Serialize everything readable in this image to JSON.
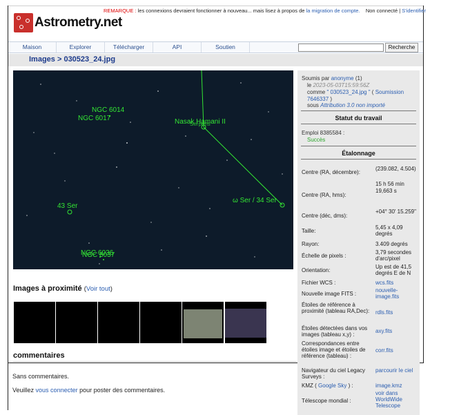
{
  "top_bar": {
    "remark_label": "REMARQUE :",
    "remark_text": "les connexions devraient fonctionner à nouveau... mais lisez à propos de",
    "migration_link": "la migration de compte.",
    "status": "Non connecté",
    "separator": "|",
    "login_link": "S'identifier"
  },
  "logo": {
    "text": "Astrometry.net"
  },
  "nav": {
    "items": [
      "Maison",
      "Explorer",
      "Télécharger",
      "API",
      "Soutien"
    ],
    "search_placeholder": "",
    "search_button": "Recherche"
  },
  "breadcrumb": {
    "text": "Images > 030523_24.jpg"
  },
  "sky_labels": {
    "ngc6014": "NGC 6014",
    "ngc6017": "NGC 6017",
    "nasak": "Nasak Hamani II",
    "nasak_overlap": "Serpens",
    "omega": "ω Ser / 34 Ser",
    "ser43": "43 Ser",
    "ngc6036": "NGC 6036",
    "ngc6037": "NGC 6037"
  },
  "nearby": {
    "title": "Images à proximité",
    "open_paren": "(",
    "link": "Voir tout",
    "close_paren": ")"
  },
  "comments": {
    "title": "commentaires",
    "none": "Sans commentaires.",
    "login_prefix": "Veuillez",
    "login_link": "vous connecter",
    "login_suffix": "pour poster des commentaires."
  },
  "submission": {
    "line1_prefix": "Soumis par",
    "user": "anonyme",
    "user_count": "(1)",
    "le": "le",
    "date": "2023-05-03T15:59:56Z",
    "comme": "comme",
    "file_link": "\" 030523_24.jpg \"",
    "submission_prefix": "(",
    "submission_link": "Soumission 7646337",
    "submission_suffix": ")",
    "sous": "sous",
    "license": "Attribution 3.0 non importé"
  },
  "job_status": {
    "title": "Statut du travail",
    "job_label": "Emploi 8385584 :",
    "status": "Succès"
  },
  "calibration": {
    "title": "Étalonnage",
    "rows": [
      {
        "label": "Centre (RA, décembre):",
        "value": "(239.082, 4.504)"
      },
      {
        "label": "Centre (RA, hms):",
        "value": "15 h 56 min 19,663 s"
      },
      {
        "label": "Centre (déc, dms):",
        "value": "+04° 30' 15.259\""
      },
      {
        "label": "Taille:",
        "value": "5,45 x 4,09 degrés"
      },
      {
        "label": "Rayon:",
        "value": "3.409 degrés"
      },
      {
        "label": "Échelle de pixels :",
        "value": "3,79 secondes d'arc/pixel"
      },
      {
        "label": "Orientation:",
        "value": "Up est de 41,5 degrés E de N"
      },
      {
        "label": "Fichier WCS :",
        "value": "wcs.fits"
      },
      {
        "label": "Nouvelle image FITS :",
        "value": "nouvelle-image.fits"
      },
      {
        "label": "Étoiles de référence à proximité (tableau RA,Dec):",
        "value": "rdls.fits"
      },
      {
        "label": "Étoiles détectées dans vos images (tableau x,y) :",
        "value": "axy.fits"
      },
      {
        "label": "Correspondances entre étoiles image et étoiles de référence (tableau) :",
        "value": "corr.fits"
      },
      {
        "label": "Navigateur du ciel Legacy Surveys :",
        "value": "parcourir le ciel"
      },
      {
        "label_prefix": "KMZ (",
        "label_link": "Google Sky",
        "label_suffix": ") :",
        "value": "image.kmz"
      },
      {
        "label": "Télescope mondial :",
        "value": "voir dans WorldWide Telescope"
      }
    ]
  },
  "colors": {
    "accent_link": "#2a5db0",
    "success": "#2aa52a",
    "annotation_green": "#33e533",
    "sky_background": "#0d1b2a"
  }
}
